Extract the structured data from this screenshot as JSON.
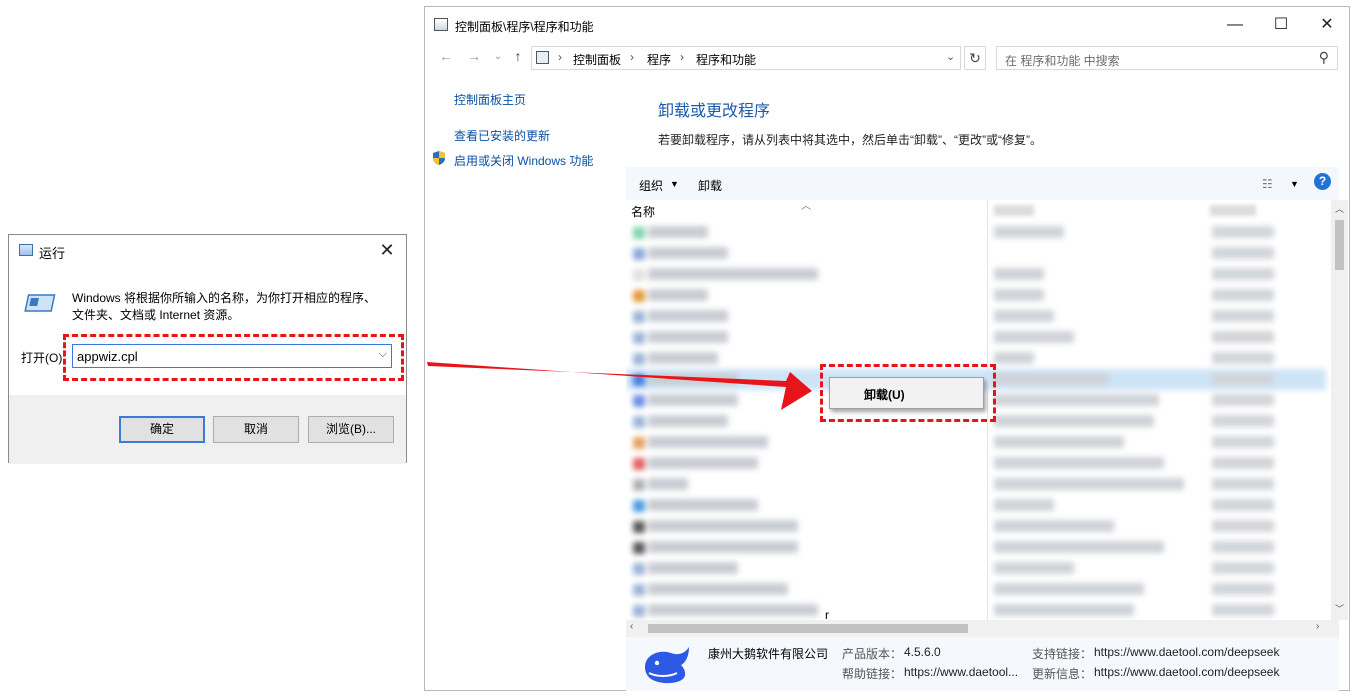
{
  "run_dialog": {
    "title": "运行",
    "description_line1": "Windows 将根据你所输入的名称，为你打开相应的程序、",
    "description_line2": "文件夹、文档或 Internet 资源。",
    "open_label": "打开(O):",
    "input_value": "appwiz.cpl",
    "ok_label": "确定",
    "cancel_label": "取消",
    "browse_label": "浏览(B)..."
  },
  "control_panel": {
    "title": "控制面板\\程序\\程序和功能",
    "breadcrumb": [
      "控制面板",
      "程序",
      "程序和功能"
    ],
    "search_placeholder": "在 程序和功能 中搜索",
    "left_nav": {
      "home": "控制面板主页",
      "installed_updates": "查看已安装的更新",
      "windows_features": "启用或关闭 Windows 功能"
    },
    "heading": "卸载或更改程序",
    "subtitle": "若要卸载程序，请从列表中将其选中，然后单击“卸载”、“更改”或“修复”。",
    "toolbar": {
      "organize": "组织",
      "uninstall": "卸载",
      "help": "?"
    },
    "list": {
      "column_name": "名称",
      "trailing_char": "r"
    },
    "context_menu": {
      "uninstall": "卸载(U)"
    },
    "details": {
      "publisher": "康州大鹅软件有限公司",
      "product_version_label": "产品版本：",
      "product_version": "4.5.6.0",
      "support_link_label": "支持链接：",
      "support_link": "https://www.daetool.com/deepseek",
      "help_link_label": "帮助链接：",
      "help_link": "https://www.daetool...",
      "update_info_label": "更新信息：",
      "update_info": "https://www.daetool.com/deepseek"
    }
  },
  "colors": {
    "highlight_red": "#e8141b",
    "link_blue": "#0b4fa3",
    "heading_blue": "#1c5bae"
  }
}
